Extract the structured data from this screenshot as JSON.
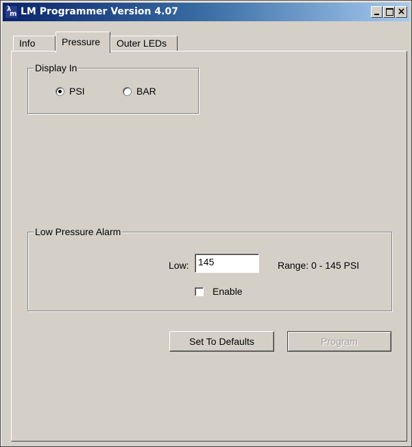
{
  "window": {
    "title": "LM Programmer Version 4.07",
    "icon_text_top": "λ",
    "icon_text_bottom": "m",
    "controls": {
      "minimize": "minimize-icon",
      "maximize": "maximize-icon",
      "close": "close-icon"
    }
  },
  "tabs": [
    {
      "label": "Info",
      "selected": false
    },
    {
      "label": "Pressure",
      "selected": true
    },
    {
      "label": "Outer LEDs",
      "selected": false
    }
  ],
  "display_in": {
    "title": "Display In",
    "options": [
      {
        "label": "PSI",
        "selected": true
      },
      {
        "label": "BAR",
        "selected": false
      }
    ]
  },
  "low_pressure_alarm": {
    "title": "Low Pressure Alarm",
    "low_label": "Low:",
    "low_value": "145",
    "range_text": "Range: 0 - 145 PSI",
    "enable_label": "Enable",
    "enable_checked": false
  },
  "buttons": {
    "set_defaults": "Set To Defaults",
    "program": "Program",
    "program_enabled": false
  },
  "colors": {
    "face": "#d4d0c8",
    "title_start": "#0a246a",
    "title_end": "#a6caf0"
  }
}
